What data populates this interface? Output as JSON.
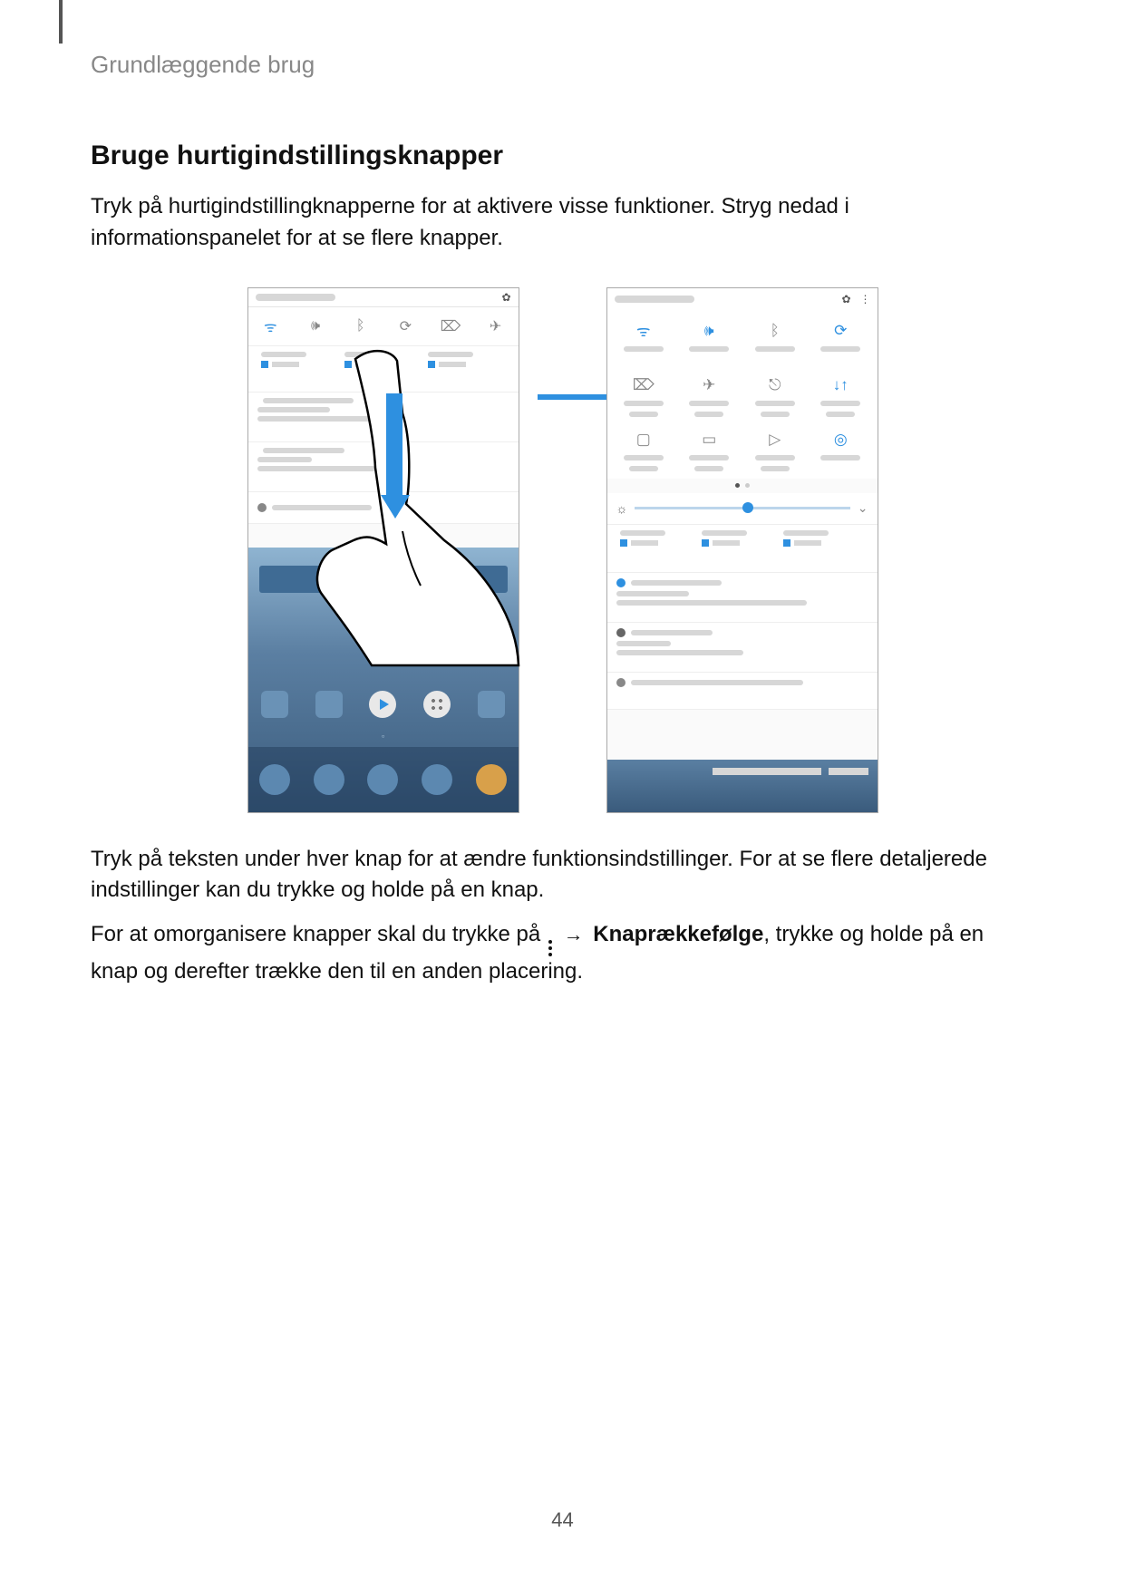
{
  "page": {
    "section_label": "Grundlæggende brug",
    "heading": "Bruge hurtigindstillingsknapper",
    "intro": "Tryk på hurtigindstillingknapperne for at aktivere visse funktioner. Stryg nedad i informationspanelet for at se flere knapper.",
    "p2": "Tryk på teksten under hver knap for at ændre funktionsindstillinger. For at se flere detaljerede indstillinger kan du trykke og holde på en knap.",
    "p3a": "For at omorganisere knapper skal du trykke på ",
    "arrow": "→",
    "p3_bold": "Knaprækkefølge",
    "p3b": ", trykke og holde på en knap og derefter trække den til en anden placering.",
    "page_number": "44"
  },
  "colors": {
    "accent": "#2e90e0"
  }
}
